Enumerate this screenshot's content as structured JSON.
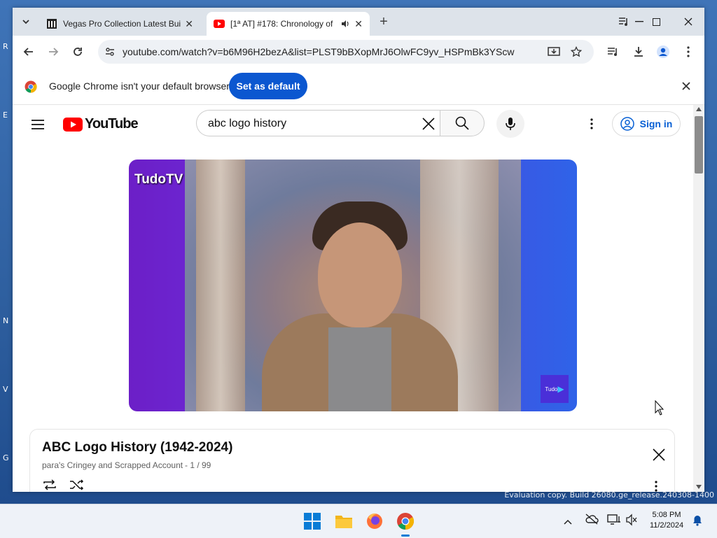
{
  "browser": {
    "tabs": [
      {
        "title": "Vegas Pro Collection Latest Buil",
        "active": false
      },
      {
        "title": "[1ª AT] #178: Chronology of",
        "active": true
      }
    ],
    "new_tab": "+",
    "url": "youtube.com/watch?v=b6M96H2bezA&list=PLST9bBXopMrJ6OlwFC9yv_HSPmBk3YScw",
    "infobar_text": "Google Chrome isn't your default browser",
    "infobar_button": "Set as default"
  },
  "youtube": {
    "logo_text": "YouTube",
    "search_value": "abc logo history",
    "signin_label": "Sign in"
  },
  "video": {
    "channel_watermark": "TudoTV",
    "corner_bug": "Tudo"
  },
  "playlist": {
    "title": "ABC Logo History (1942-2024)",
    "owner": "para's Cringey and Scrapped Account",
    "position": "- 1 / 99"
  },
  "taskbar": {
    "time": "5:08 PM",
    "date": "11/2/2024",
    "watermark": "Evaluation copy. Build 26080.ge_release.240308-1400"
  },
  "colors": {
    "accent": "#0b57d0",
    "youtube_red": "#ff0000",
    "tabstrip": "#dde3ea"
  }
}
